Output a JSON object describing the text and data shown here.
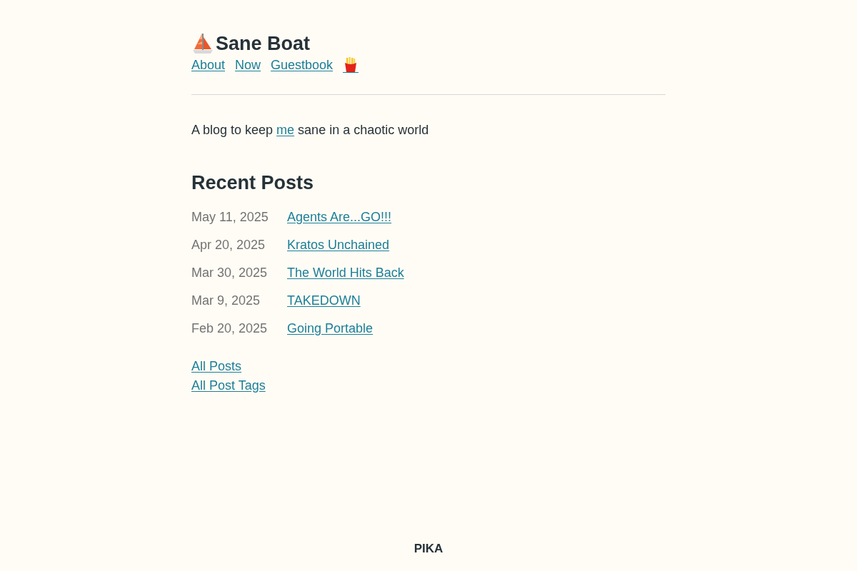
{
  "site": {
    "title": "Sane Boat",
    "nav": [
      "About",
      "Now",
      "Guestbook"
    ]
  },
  "tagline": {
    "before": "A blog to keep ",
    "link": "me",
    "after": " sane in a chaotic world"
  },
  "recent_posts": {
    "heading": "Recent Posts",
    "posts": [
      {
        "date": "May 11, 2025",
        "title": "Agents Are...GO!!!"
      },
      {
        "date": "Apr 20, 2025",
        "title": "Kratos Unchained"
      },
      {
        "date": "Mar 30, 2025",
        "title": "The World Hits Back"
      },
      {
        "date": "Mar 9, 2025",
        "title": "TAKEDOWN"
      },
      {
        "date": "Feb 20, 2025",
        "title": "Going Portable"
      }
    ]
  },
  "more_links": [
    "All Posts",
    "All Post Tags"
  ],
  "footer": "PIKA"
}
